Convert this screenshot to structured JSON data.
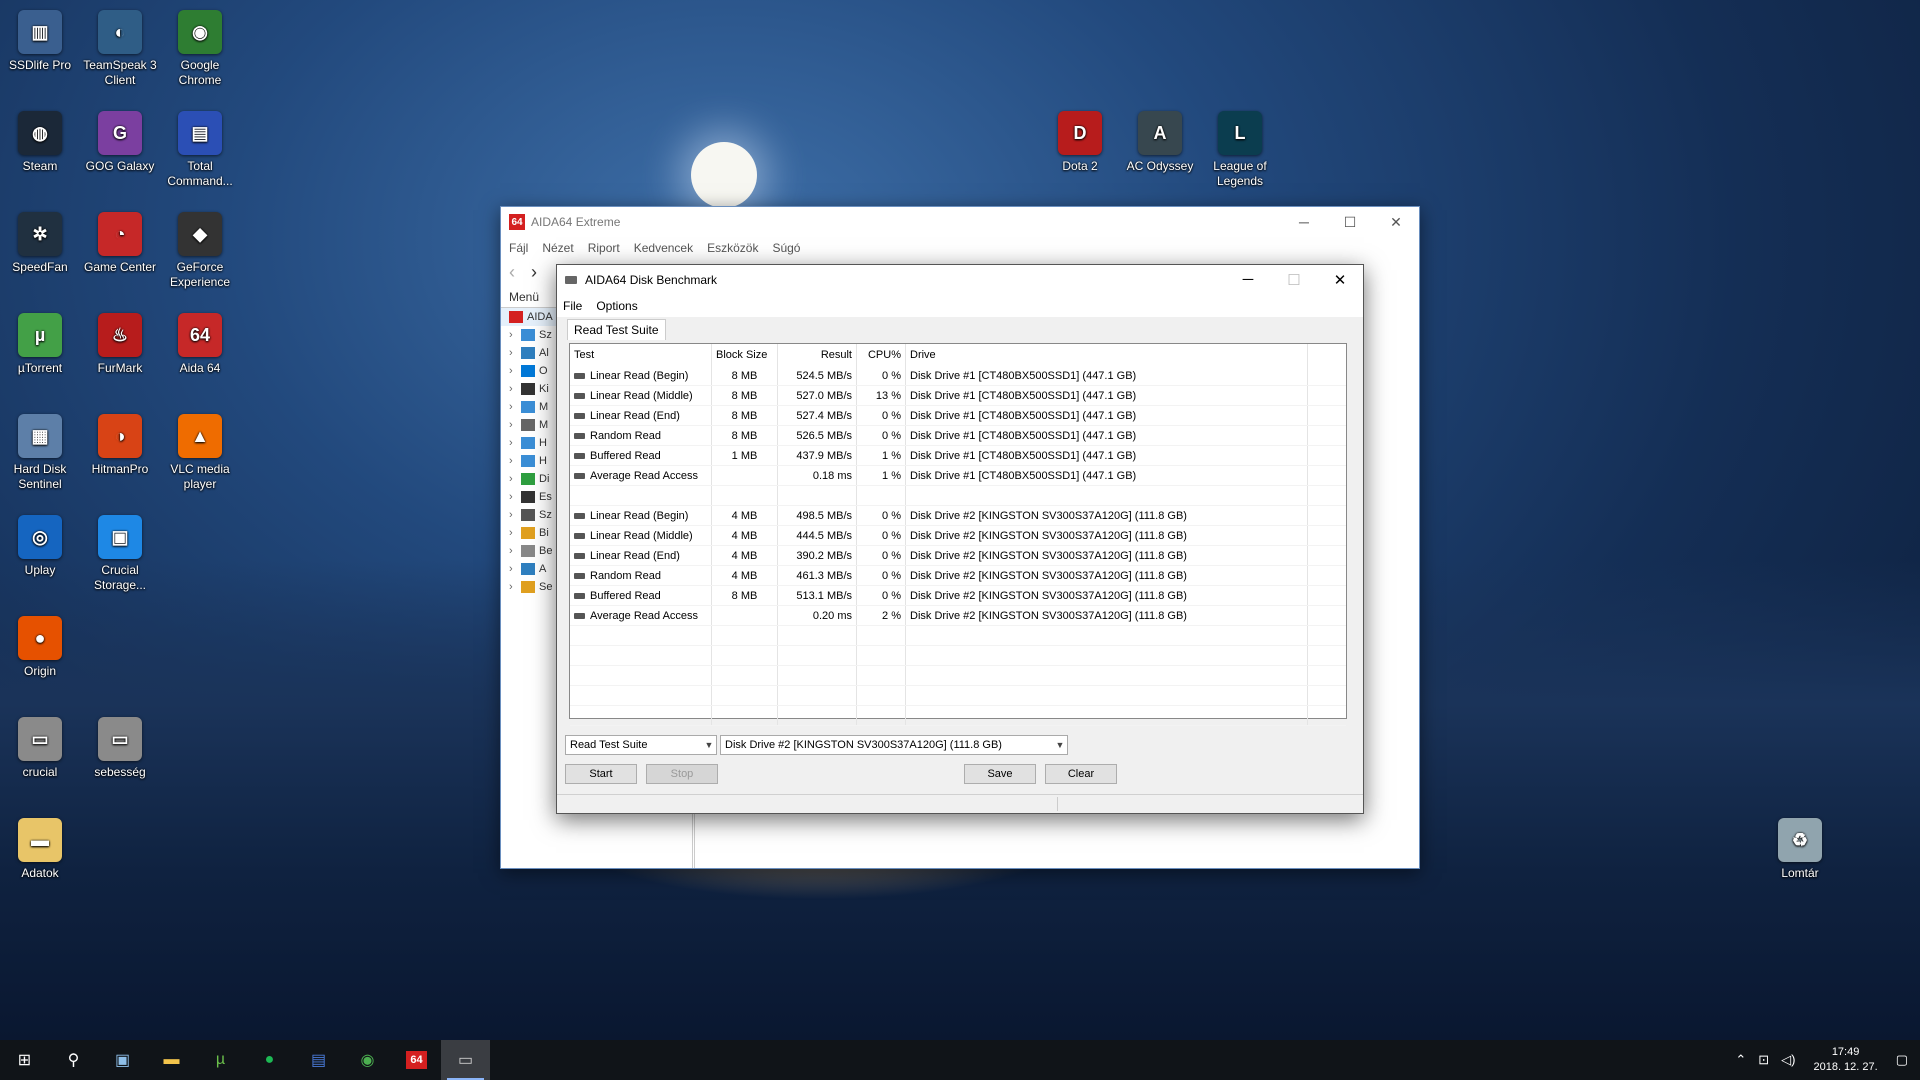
{
  "desktop": {
    "icons": [
      {
        "label": "SSDlife Pro",
        "color": "#3a5f8f",
        "glyph": "▥"
      },
      {
        "label": "TeamSpeak 3 Client",
        "color": "#2f5d86",
        "glyph": "◐"
      },
      {
        "label": "Google Chrome",
        "color": "#2e7d32",
        "glyph": "◉"
      },
      {
        "label": "Steam",
        "color": "#1b2838",
        "glyph": "◍"
      },
      {
        "label": "GOG Galaxy",
        "color": "#7b3fa0",
        "glyph": "G"
      },
      {
        "label": "Total Command...",
        "color": "#2b4fb5",
        "glyph": "▤"
      },
      {
        "label": "SpeedFan",
        "color": "#203040",
        "glyph": "✲"
      },
      {
        "label": "Game Center",
        "color": "#c62828",
        "glyph": "◔"
      },
      {
        "label": "GeForce Experience",
        "color": "#333",
        "glyph": "◆"
      },
      {
        "label": "µTorrent",
        "color": "#43a047",
        "glyph": "µ"
      },
      {
        "label": "FurMark",
        "color": "#b71c1c",
        "glyph": "♨"
      },
      {
        "label": "Aida 64",
        "color": "#c62828",
        "glyph": "64"
      },
      {
        "label": "Hard Disk Sentinel",
        "color": "#5d7fa8",
        "glyph": "▦"
      },
      {
        "label": "HitmanPro",
        "color": "#d84315",
        "glyph": "◑"
      },
      {
        "label": "VLC media player",
        "color": "#ef6c00",
        "glyph": "▲"
      },
      {
        "label": "Uplay",
        "color": "#1565c0",
        "glyph": "◎"
      },
      {
        "label": "Crucial Storage...",
        "color": "#1e88e5",
        "glyph": "▣"
      },
      {
        "label": "Origin",
        "color": "#e65100",
        "glyph": "●"
      },
      {
        "label": "crucial",
        "color": "#8a8a8a",
        "glyph": "▭"
      },
      {
        "label": "sebesség",
        "color": "#8a8a8a",
        "glyph": "▭"
      },
      {
        "label": "Adatok",
        "color": "#e8c568",
        "glyph": "▬"
      },
      {
        "label": "Dota 2",
        "color": "#b71c1c",
        "glyph": "D"
      },
      {
        "label": "AC Odyssey",
        "color": "#37474f",
        "glyph": "A"
      },
      {
        "label": "League of Legends",
        "color": "#0b3d4f",
        "glyph": "L"
      },
      {
        "label": "Lomtár",
        "color": "#90a4ae",
        "glyph": "♻"
      }
    ]
  },
  "main_window": {
    "title": "AIDA64 Extreme",
    "logo": "64",
    "menu": [
      "Fájl",
      "Nézet",
      "Riport",
      "Kedvencek",
      "Eszközök",
      "Súgó"
    ],
    "left_header": "Menü",
    "tree_root": "AIDA",
    "tree_items": [
      "Sz",
      "Al",
      "O",
      "Ki",
      "M",
      "M",
      "H",
      "H",
      "Di",
      "Es",
      "Sz",
      "Bi",
      "Be",
      "A",
      "Se"
    ],
    "controls": {
      "minimize": "─",
      "maximize": "☐",
      "close": "✕"
    }
  },
  "dialog": {
    "title": "AIDA64 Disk Benchmark",
    "menu": [
      "File",
      "Options"
    ],
    "tab": "Read Test Suite",
    "columns": [
      "Test",
      "Block Size",
      "Result",
      "CPU%",
      "Drive"
    ],
    "rows": [
      {
        "test": "Linear Read (Begin)",
        "block": "8 MB",
        "result": "524.5 MB/s",
        "cpu": "0 %",
        "drive": "Disk Drive #1  [CT480BX500SSD1]  (447.1 GB)"
      },
      {
        "test": "Linear Read (Middle)",
        "block": "8 MB",
        "result": "527.0 MB/s",
        "cpu": "13 %",
        "drive": "Disk Drive #1  [CT480BX500SSD1]  (447.1 GB)"
      },
      {
        "test": "Linear Read (End)",
        "block": "8 MB",
        "result": "527.4 MB/s",
        "cpu": "0 %",
        "drive": "Disk Drive #1  [CT480BX500SSD1]  (447.1 GB)"
      },
      {
        "test": "Random Read",
        "block": "8 MB",
        "result": "526.5 MB/s",
        "cpu": "0 %",
        "drive": "Disk Drive #1  [CT480BX500SSD1]  (447.1 GB)"
      },
      {
        "test": "Buffered Read",
        "block": "1 MB",
        "result": "437.9 MB/s",
        "cpu": "1 %",
        "drive": "Disk Drive #1  [CT480BX500SSD1]  (447.1 GB)"
      },
      {
        "test": "Average Read Access",
        "block": "",
        "result": "0.18 ms",
        "cpu": "1 %",
        "drive": "Disk Drive #1  [CT480BX500SSD1]  (447.1 GB)"
      },
      {
        "test": "",
        "block": "",
        "result": "",
        "cpu": "",
        "drive": ""
      },
      {
        "test": "Linear Read (Begin)",
        "block": "4 MB",
        "result": "498.5 MB/s",
        "cpu": "0 %",
        "drive": "Disk Drive #2  [KINGSTON SV300S37A120G]  (111.8 GB)"
      },
      {
        "test": "Linear Read (Middle)",
        "block": "4 MB",
        "result": "444.5 MB/s",
        "cpu": "0 %",
        "drive": "Disk Drive #2  [KINGSTON SV300S37A120G]  (111.8 GB)"
      },
      {
        "test": "Linear Read (End)",
        "block": "4 MB",
        "result": "390.2 MB/s",
        "cpu": "0 %",
        "drive": "Disk Drive #2  [KINGSTON SV300S37A120G]  (111.8 GB)"
      },
      {
        "test": "Random Read",
        "block": "4 MB",
        "result": "461.3 MB/s",
        "cpu": "0 %",
        "drive": "Disk Drive #2  [KINGSTON SV300S37A120G]  (111.8 GB)"
      },
      {
        "test": "Buffered Read",
        "block": "8 MB",
        "result": "513.1 MB/s",
        "cpu": "0 %",
        "drive": "Disk Drive #2  [KINGSTON SV300S37A120G]  (111.8 GB)"
      },
      {
        "test": "Average Read Access",
        "block": "",
        "result": "0.20 ms",
        "cpu": "2 %",
        "drive": "Disk Drive #2  [KINGSTON SV300S37A120G]  (111.8 GB)"
      }
    ],
    "suite_select": "Read Test Suite",
    "drive_select": "Disk Drive #2  [KINGSTON SV300S37A120G]  (111.8 GB)",
    "buttons": {
      "start": "Start",
      "stop": "Stop",
      "save": "Save",
      "clear": "Clear"
    },
    "controls": {
      "minimize": "─",
      "maximize": "☐",
      "close": "✕"
    }
  },
  "taskbar": {
    "clock_time": "17:49",
    "clock_date": "2018. 12. 27.",
    "apps": [
      "start-button",
      "search",
      "task-view",
      "file-explorer",
      "utorrent",
      "spotify",
      "total-commander",
      "chrome",
      "aida64",
      "disk-benchmark"
    ]
  },
  "colors": {
    "accent": "#8ab4f8",
    "aida_red": "#d42020"
  }
}
